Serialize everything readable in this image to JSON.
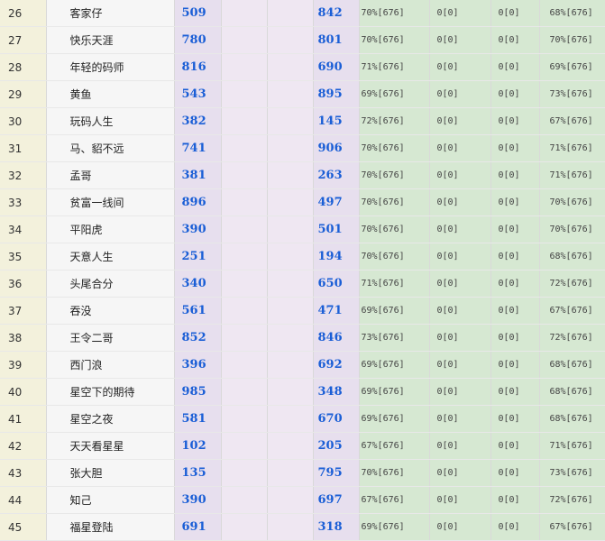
{
  "rows": [
    {
      "idx": "26",
      "name": "客家仔",
      "a": "509",
      "b": "842",
      "g1": "70%[676]",
      "g2": "0[0]",
      "g3": "0[0]",
      "g4": "68%[676]"
    },
    {
      "idx": "27",
      "name": "快乐天涯",
      "a": "780",
      "b": "801",
      "g1": "70%[676]",
      "g2": "0[0]",
      "g3": "0[0]",
      "g4": "70%[676]"
    },
    {
      "idx": "28",
      "name": "年轻的码师",
      "a": "816",
      "b": "690",
      "g1": "71%[676]",
      "g2": "0[0]",
      "g3": "0[0]",
      "g4": "69%[676]"
    },
    {
      "idx": "29",
      "name": "黄鱼",
      "a": "543",
      "b": "895",
      "g1": "69%[676]",
      "g2": "0[0]",
      "g3": "0[0]",
      "g4": "73%[676]"
    },
    {
      "idx": "30",
      "name": "玩码人生",
      "a": "382",
      "b": "145",
      "g1": "72%[676]",
      "g2": "0[0]",
      "g3": "0[0]",
      "g4": "67%[676]"
    },
    {
      "idx": "31",
      "name": "马、貂不远",
      "a": "741",
      "b": "906",
      "g1": "70%[676]",
      "g2": "0[0]",
      "g3": "0[0]",
      "g4": "71%[676]"
    },
    {
      "idx": "32",
      "name": "孟哥",
      "a": "381",
      "b": "263",
      "g1": "70%[676]",
      "g2": "0[0]",
      "g3": "0[0]",
      "g4": "71%[676]"
    },
    {
      "idx": "33",
      "name": "贫富一线间",
      "a": "896",
      "b": "497",
      "g1": "70%[676]",
      "g2": "0[0]",
      "g3": "0[0]",
      "g4": "70%[676]"
    },
    {
      "idx": "34",
      "name": "平阳虎",
      "a": "390",
      "b": "501",
      "g1": "70%[676]",
      "g2": "0[0]",
      "g3": "0[0]",
      "g4": "70%[676]"
    },
    {
      "idx": "35",
      "name": "天意人生",
      "a": "251",
      "b": "194",
      "g1": "70%[676]",
      "g2": "0[0]",
      "g3": "0[0]",
      "g4": "68%[676]"
    },
    {
      "idx": "36",
      "name": "头尾合分",
      "a": "340",
      "b": "650",
      "g1": "71%[676]",
      "g2": "0[0]",
      "g3": "0[0]",
      "g4": "72%[676]"
    },
    {
      "idx": "37",
      "name": "吞没",
      "a": "561",
      "b": "471",
      "g1": "69%[676]",
      "g2": "0[0]",
      "g3": "0[0]",
      "g4": "67%[676]"
    },
    {
      "idx": "38",
      "name": "王令二哥",
      "a": "852",
      "b": "846",
      "g1": "73%[676]",
      "g2": "0[0]",
      "g3": "0[0]",
      "g4": "72%[676]"
    },
    {
      "idx": "39",
      "name": "西门浪",
      "a": "396",
      "b": "692",
      "g1": "69%[676]",
      "g2": "0[0]",
      "g3": "0[0]",
      "g4": "68%[676]"
    },
    {
      "idx": "40",
      "name": "星空下的期待",
      "a": "985",
      "b": "348",
      "g1": "69%[676]",
      "g2": "0[0]",
      "g3": "0[0]",
      "g4": "68%[676]"
    },
    {
      "idx": "41",
      "name": "星空之夜",
      "a": "581",
      "b": "670",
      "g1": "69%[676]",
      "g2": "0[0]",
      "g3": "0[0]",
      "g4": "68%[676]"
    },
    {
      "idx": "42",
      "name": "天天看星星",
      "a": "102",
      "b": "205",
      "g1": "67%[676]",
      "g2": "0[0]",
      "g3": "0[0]",
      "g4": "71%[676]"
    },
    {
      "idx": "43",
      "name": "张大胆",
      "a": "135",
      "b": "795",
      "g1": "70%[676]",
      "g2": "0[0]",
      "g3": "0[0]",
      "g4": "73%[676]"
    },
    {
      "idx": "44",
      "name": "知己",
      "a": "390",
      "b": "697",
      "g1": "67%[676]",
      "g2": "0[0]",
      "g3": "0[0]",
      "g4": "72%[676]"
    },
    {
      "idx": "45",
      "name": "福星登陆",
      "a": "691",
      "b": "318",
      "g1": "69%[676]",
      "g2": "0[0]",
      "g3": "0[0]",
      "g4": "67%[676]"
    }
  ]
}
